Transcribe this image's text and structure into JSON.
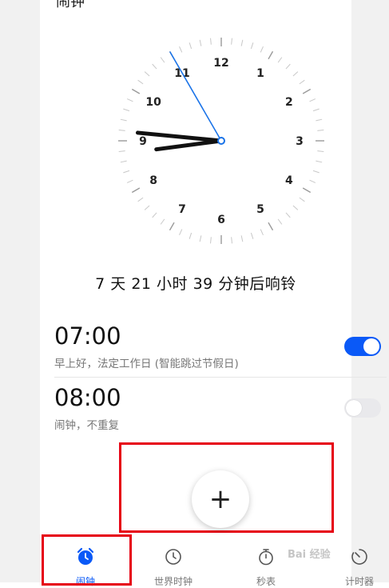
{
  "header": {
    "title": "闹钟"
  },
  "clock": {
    "numbers": [
      "12",
      "1",
      "2",
      "3",
      "4",
      "5",
      "6",
      "7",
      "8",
      "9",
      "10",
      "11"
    ],
    "time": {
      "hour": 8,
      "minute": 45,
      "second": 55
    },
    "second_hand_color": "#1a73e8"
  },
  "countdown": "7 天 21 小时 39 分钟后响铃",
  "alarms": [
    {
      "time": "07:00",
      "description": "早上好，法定工作日 (智能跳过节假日)",
      "enabled": true
    },
    {
      "time": "08:00",
      "description": "闹钟，不重复",
      "enabled": false
    }
  ],
  "add_button": {
    "symbol": "+"
  },
  "tabs": [
    {
      "label": "闹钟",
      "icon": "alarm-clock-icon",
      "active": true
    },
    {
      "label": "世界时钟",
      "icon": "world-clock-icon",
      "active": false
    },
    {
      "label": "秒表",
      "icon": "stopwatch-icon",
      "active": false
    },
    {
      "label": "计时器",
      "icon": "timer-icon",
      "active": false
    }
  ],
  "watermark": "Bai 经验",
  "colors": {
    "accent": "#0a59f7",
    "highlight": "#e60012"
  }
}
